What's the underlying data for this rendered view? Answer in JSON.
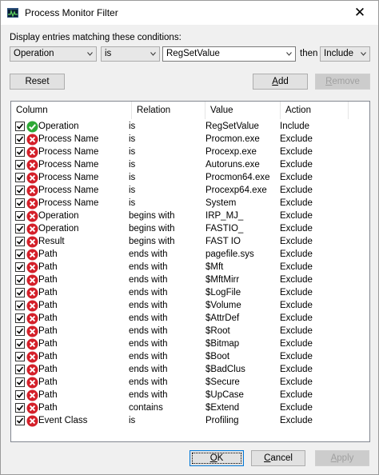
{
  "window": {
    "title": "Process Monitor Filter",
    "close_glyph": "✕"
  },
  "condition": {
    "label": "Display entries matching these conditions:",
    "column_value": "Operation",
    "relation_value": "is",
    "value_text": "RegSetValue",
    "then_label": "then",
    "action_value": "Include"
  },
  "buttons": {
    "reset": "Reset",
    "add_prefix": "",
    "add_mnemonic": "A",
    "add_rest": "dd",
    "remove_prefix": "",
    "remove_mnemonic": "R",
    "remove_rest": "emove",
    "ok_prefix": "",
    "ok_mnemonic": "O",
    "ok_rest": "K",
    "cancel_prefix": "",
    "cancel_mnemonic": "C",
    "cancel_rest": "ancel",
    "apply_prefix": "",
    "apply_mnemonic": "A",
    "apply_rest": "pply"
  },
  "colors": {
    "include_icon": "#2ea836",
    "exclude_icon": "#d4202a",
    "default_border": "#0078d7"
  },
  "list": {
    "headers": [
      "Column",
      "Relation",
      "Value",
      "Action"
    ],
    "rows": [
      {
        "column": "Operation",
        "relation": "is",
        "value": "RegSetValue",
        "action": "Include",
        "icon": "check-circle-icon"
      },
      {
        "column": "Process Name",
        "relation": "is",
        "value": "Procmon.exe",
        "action": "Exclude",
        "icon": "x-circle-icon"
      },
      {
        "column": "Process Name",
        "relation": "is",
        "value": "Procexp.exe",
        "action": "Exclude",
        "icon": "x-circle-icon"
      },
      {
        "column": "Process Name",
        "relation": "is",
        "value": "Autoruns.exe",
        "action": "Exclude",
        "icon": "x-circle-icon"
      },
      {
        "column": "Process Name",
        "relation": "is",
        "value": "Procmon64.exe",
        "action": "Exclude",
        "icon": "x-circle-icon"
      },
      {
        "column": "Process Name",
        "relation": "is",
        "value": "Procexp64.exe",
        "action": "Exclude",
        "icon": "x-circle-icon"
      },
      {
        "column": "Process Name",
        "relation": "is",
        "value": "System",
        "action": "Exclude",
        "icon": "x-circle-icon"
      },
      {
        "column": "Operation",
        "relation": "begins with",
        "value": "IRP_MJ_",
        "action": "Exclude",
        "icon": "x-circle-icon"
      },
      {
        "column": "Operation",
        "relation": "begins with",
        "value": "FASTIO_",
        "action": "Exclude",
        "icon": "x-circle-icon"
      },
      {
        "column": "Result",
        "relation": "begins with",
        "value": "FAST IO",
        "action": "Exclude",
        "icon": "x-circle-icon"
      },
      {
        "column": "Path",
        "relation": "ends with",
        "value": "pagefile.sys",
        "action": "Exclude",
        "icon": "x-circle-icon"
      },
      {
        "column": "Path",
        "relation": "ends with",
        "value": "$Mft",
        "action": "Exclude",
        "icon": "x-circle-icon"
      },
      {
        "column": "Path",
        "relation": "ends with",
        "value": "$MftMirr",
        "action": "Exclude",
        "icon": "x-circle-icon"
      },
      {
        "column": "Path",
        "relation": "ends with",
        "value": "$LogFile",
        "action": "Exclude",
        "icon": "x-circle-icon"
      },
      {
        "column": "Path",
        "relation": "ends with",
        "value": "$Volume",
        "action": "Exclude",
        "icon": "x-circle-icon"
      },
      {
        "column": "Path",
        "relation": "ends with",
        "value": "$AttrDef",
        "action": "Exclude",
        "icon": "x-circle-icon"
      },
      {
        "column": "Path",
        "relation": "ends with",
        "value": "$Root",
        "action": "Exclude",
        "icon": "x-circle-icon"
      },
      {
        "column": "Path",
        "relation": "ends with",
        "value": "$Bitmap",
        "action": "Exclude",
        "icon": "x-circle-icon"
      },
      {
        "column": "Path",
        "relation": "ends with",
        "value": "$Boot",
        "action": "Exclude",
        "icon": "x-circle-icon"
      },
      {
        "column": "Path",
        "relation": "ends with",
        "value": "$BadClus",
        "action": "Exclude",
        "icon": "x-circle-icon"
      },
      {
        "column": "Path",
        "relation": "ends with",
        "value": "$Secure",
        "action": "Exclude",
        "icon": "x-circle-icon"
      },
      {
        "column": "Path",
        "relation": "ends with",
        "value": "$UpCase",
        "action": "Exclude",
        "icon": "x-circle-icon"
      },
      {
        "column": "Path",
        "relation": "contains",
        "value": "$Extend",
        "action": "Exclude",
        "icon": "x-circle-icon"
      },
      {
        "column": "Event Class",
        "relation": "is",
        "value": "Profiling",
        "action": "Exclude",
        "icon": "x-circle-icon"
      }
    ]
  }
}
